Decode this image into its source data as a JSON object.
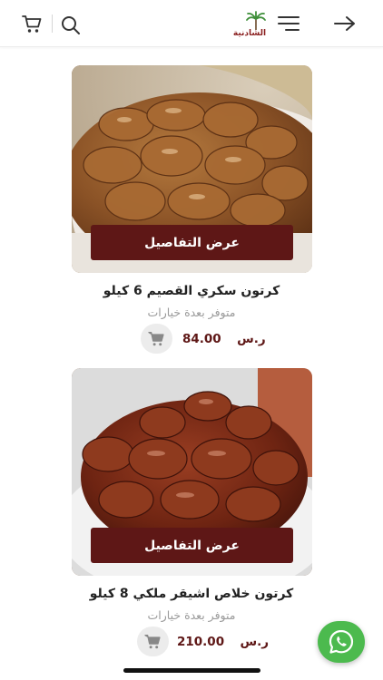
{
  "header": {
    "logo_text": "الشادنية",
    "icons": [
      "cart-icon",
      "search-icon",
      "menu-icon",
      "back-arrow-icon"
    ]
  },
  "products": [
    {
      "title": "كرتون سكري القصيم 6 كيلو",
      "availability": "متوفر بعدة خيارات",
      "price": "84.00",
      "currency": "ر.س",
      "details_label": "عرض التفاصيل"
    },
    {
      "title": "كرتون خلاص اشيقر ملكي 8 كيلو",
      "availability": "متوفر بعدة خيارات",
      "price": "210.00",
      "currency": "ر.س",
      "details_label": "عرض التفاصيل"
    }
  ],
  "colors": {
    "accent": "#5e1716",
    "whatsapp": "#4cba4e"
  }
}
